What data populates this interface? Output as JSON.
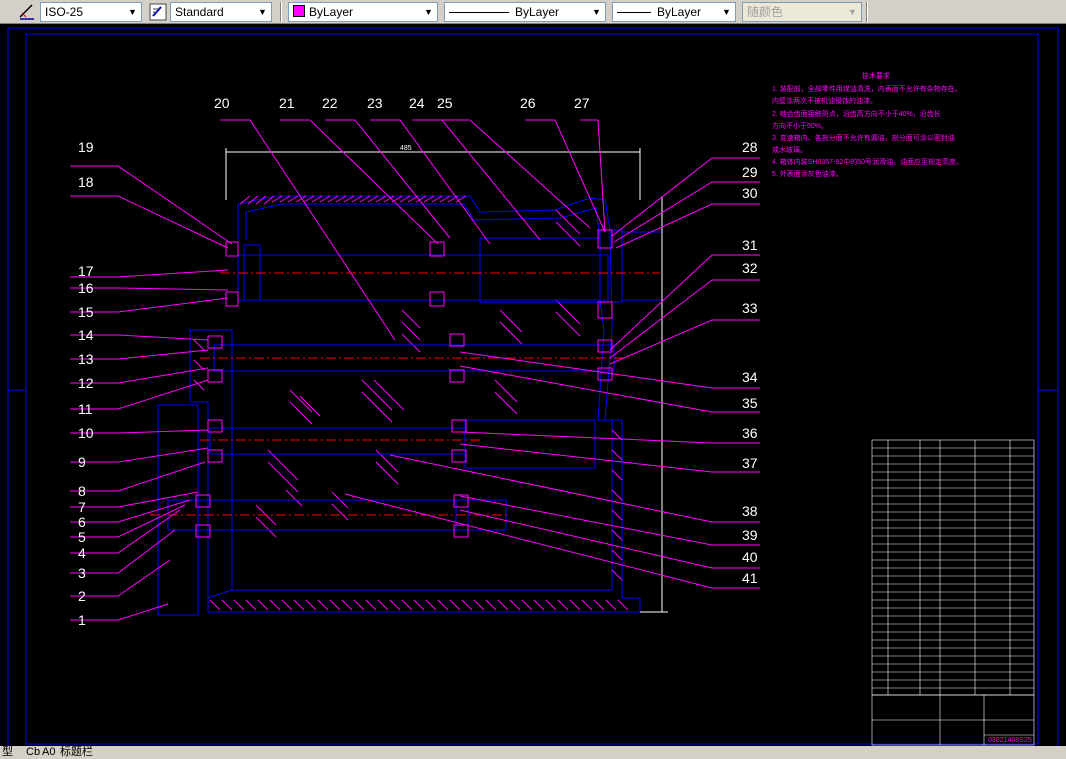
{
  "toolbar": {
    "dimstyle": "ISO-25",
    "textstyle": "Standard",
    "layer_color": "ByLayer",
    "linetype": "ByLayer",
    "lineweight": "ByLayer",
    "plotstyle": "随颜色"
  },
  "drawing": {
    "callouts_left": [
      "1",
      "2",
      "3",
      "4",
      "5",
      "6",
      "7",
      "8",
      "9",
      "10",
      "11",
      "12",
      "13",
      "14",
      "15",
      "16",
      "17",
      "18",
      "19"
    ],
    "callouts_top": [
      "20",
      "21",
      "22",
      "23",
      "24",
      "25",
      "26",
      "27"
    ],
    "callouts_right": [
      "28",
      "29",
      "30",
      "31",
      "32",
      "33",
      "34",
      "35",
      "36",
      "37",
      "38",
      "39",
      "40",
      "41"
    ],
    "overall_width_dim": "485",
    "tech_req_title": "技术要求",
    "tech_req": [
      "1. 装配前，全部零件用煤油清洗，内表面不允许有杂物存在。",
      "   内壁涂两次不被机油侵蚀的油漆。",
      "2. 啮合齿面接触斑点，沿齿高方向不小于40%，沿齿长",
      "   方向不小于50%。",
      "3. 变速箱内、各剖分面不允许有漏油，剖分面可涂以密封油",
      "   或水玻璃。",
      "4. 箱体内装SH0357-92中的50号润滑油，油面应至规定高度。",
      "5. 外表面涂灰色油漆。"
    ],
    "title_block_drawing_no": "03021408S25"
  },
  "tabs": {
    "prev_label": "型",
    "model_label": "Cb",
    "layout1_label": "A0",
    "layout2_label": "标题栏"
  }
}
